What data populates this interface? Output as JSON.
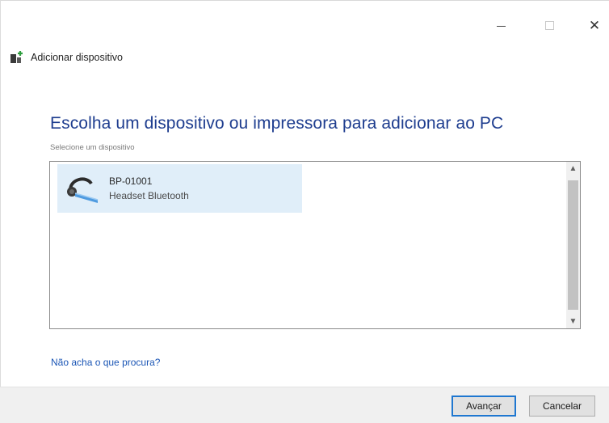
{
  "window": {
    "title": "Adicionar dispositivo",
    "caption_buttons": [
      "minimize",
      "maximize",
      "close"
    ],
    "close_glyph": "✕"
  },
  "main": {
    "heading": "Escolha um dispositivo ou impressora para adicionar ao PC",
    "subheading": "Selecione um dispositivo",
    "devices": [
      {
        "name": "BP-01001",
        "type": "Headset Bluetooth",
        "icon": "bluetooth-headset-icon",
        "selected": true
      }
    ],
    "help_link": "Não acha o que procura?"
  },
  "footer": {
    "next_label": "Avançar",
    "cancel_label": "Cancelar"
  },
  "colors": {
    "heading": "#1e3d8f",
    "link": "#1a55b5",
    "selection": "#e0eef9",
    "default_button_border": "#1f77d0"
  }
}
